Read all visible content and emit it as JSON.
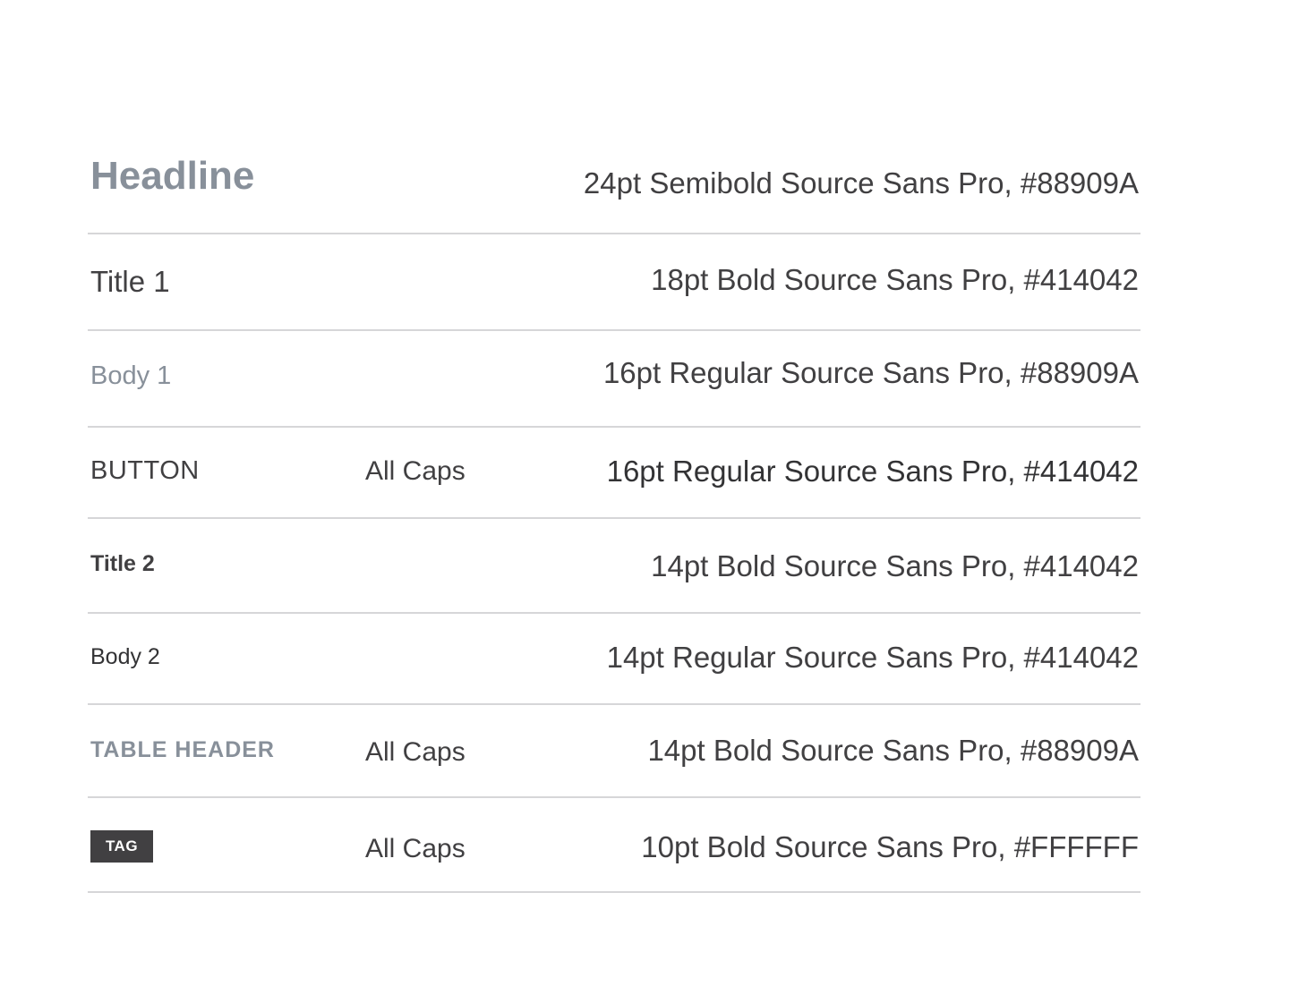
{
  "colors": {
    "gray": "#88909A",
    "dark": "#414042",
    "white": "#FFFFFF",
    "divider": "#D6D6D8"
  },
  "rows": [
    {
      "sample": "Headline",
      "note": "",
      "spec": "24pt Semibold Source Sans Pro, #88909A"
    },
    {
      "sample": "Title 1",
      "note": "",
      "spec": "18pt Bold Source Sans Pro, #414042"
    },
    {
      "sample": "Body 1",
      "note": "",
      "spec": "16pt Regular Source Sans Pro, #88909A"
    },
    {
      "sample": "BUTTON",
      "note": "All Caps",
      "spec": "16pt Regular Source Sans Pro, #414042"
    },
    {
      "sample": "Title 2",
      "note": "",
      "spec": "14pt Bold Source Sans Pro, #414042"
    },
    {
      "sample": "Body 2",
      "note": "",
      "spec": "14pt Regular Source Sans Pro, #414042"
    },
    {
      "sample": "TABLE HEADER",
      "note": "All Caps",
      "spec": "14pt Bold Source Sans Pro, #88909A"
    },
    {
      "sample": "TAG",
      "note": "All Caps",
      "spec": "10pt Bold Source Sans Pro, #FFFFFF"
    }
  ]
}
